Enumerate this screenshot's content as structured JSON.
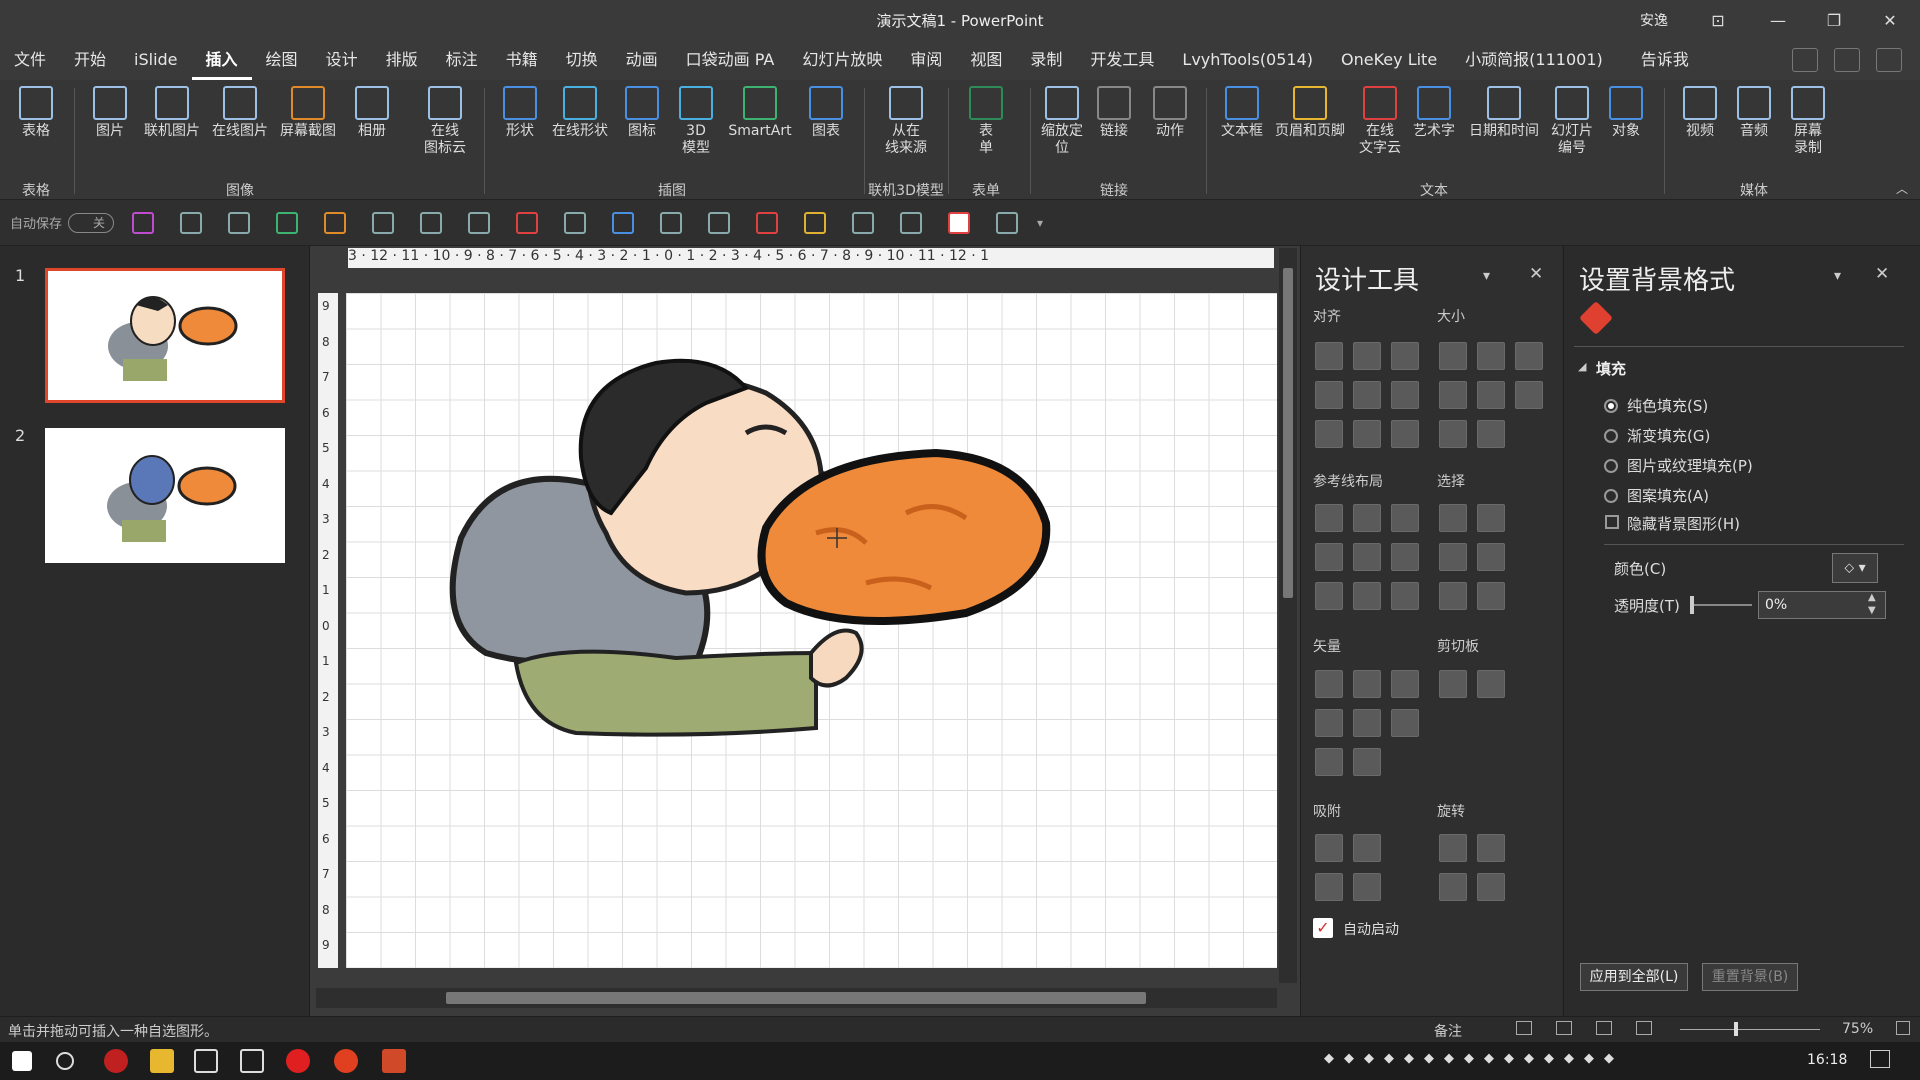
{
  "titlebar": {
    "title": "演示文稿1 - PowerPoint",
    "user": "安逸",
    "win_restore": "⊡",
    "win_min": "—",
    "win_max": "❐",
    "win_close": "✕"
  },
  "menu": [
    "文件",
    "开始",
    "iSlide",
    "插入",
    "绘图",
    "设计",
    "排版",
    "标注",
    "书籍",
    "切换",
    "动画",
    "口袋动画 PA",
    "幻灯片放映",
    "审阅",
    "视图",
    "录制",
    "开发工具",
    "LvyhTools(0514)",
    "OneKey Lite",
    "小顽简报(111001)",
    "告诉我"
  ],
  "menu_active": "插入",
  "ribbon": {
    "buttons": [
      "表格",
      "图片",
      "联机图片",
      "在线图片",
      "屏幕截图",
      "相册",
      "在线\n图标云",
      "形状",
      "在线形状",
      "图标",
      "3D\n模型",
      "SmartArt",
      "图表",
      "从在\n线来源",
      "表\n单",
      "缩放定\n位",
      "链接",
      "动作",
      "文本框",
      "页眉和页脚",
      "在线\n文字云",
      "艺术字",
      "日期和时间",
      "幻灯片\n编号",
      "对象",
      "视频",
      "音频",
      "屏幕\n录制"
    ],
    "groups": [
      "表格",
      "图像",
      "插图",
      "联机3D模型",
      "表单",
      "链接",
      "文本",
      "媒体"
    ]
  },
  "qat": {
    "autosave": "自动保存",
    "toggle": "关"
  },
  "thumbs": {
    "nums": [
      "1",
      "2"
    ]
  },
  "ruler": {
    "h": "3 · 12 · 11 · 10 · 9 · 8 · 7 · 6 · 5 · 4 · 3 · 2 · 1 · 0 · 1 · 2 · 3 · 4 · 5 · 6 · 7 · 8 · 9 · 10 · 11 · 12 · 1",
    "v": [
      "9",
      "8",
      "7",
      "6",
      "5",
      "4",
      "3",
      "2",
      "1",
      "0",
      "1",
      "2",
      "3",
      "4",
      "5",
      "6",
      "7",
      "8",
      "9"
    ]
  },
  "design": {
    "title": "设计工具",
    "sections": [
      "对齐",
      "大小",
      "参考线布局",
      "选择",
      "矢量",
      "剪切板",
      "吸附",
      "旋转"
    ],
    "auto": "自动启动"
  },
  "format": {
    "title": "设置背景格式",
    "fill": "填充",
    "options": [
      "纯色填充(S)",
      "渐变填充(G)",
      "图片或纹理填充(P)",
      "图案填充(A)"
    ],
    "hide": "隐藏背景图形(H)",
    "color": "颜色(C)",
    "transparency": "透明度(T)",
    "transparency_value": "0%",
    "apply_all": "应用到全部(L)",
    "reset": "重置背景(B)"
  },
  "status": {
    "hint": "单击并拖动可插入一种自选图形。",
    "notes": "备注",
    "zoom": "75%"
  },
  "taskbar": {
    "time": "16:18"
  },
  "colors": {
    "accent": "#e0462a",
    "ribbon_bg": "#363636",
    "title_bg": "#3a3a3a"
  }
}
